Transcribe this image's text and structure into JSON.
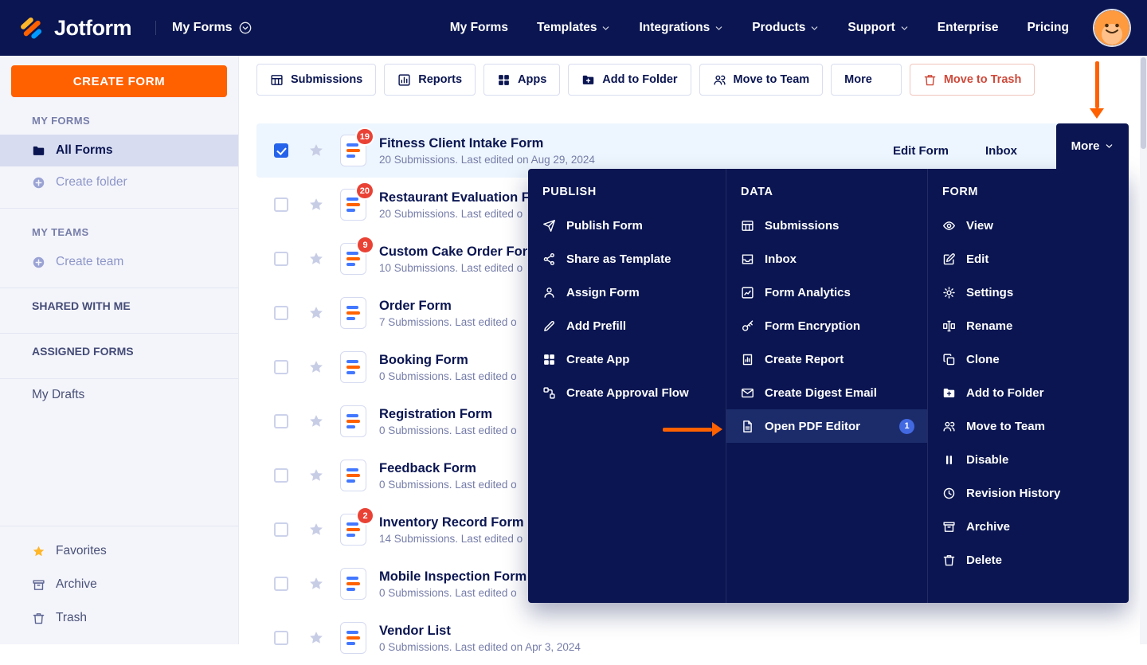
{
  "navbar": {
    "logo_text": "Jotform",
    "context_label": "My Forms",
    "items": [
      {
        "label": "My Forms",
        "chevron": false
      },
      {
        "label": "Templates",
        "chevron": true
      },
      {
        "label": "Integrations",
        "chevron": true
      },
      {
        "label": "Products",
        "chevron": true
      },
      {
        "label": "Support",
        "chevron": true
      },
      {
        "label": "Enterprise",
        "chevron": false
      },
      {
        "label": "Pricing",
        "chevron": false
      }
    ],
    "avatar_icon": "user-avatar-icon"
  },
  "sidebar": {
    "create_form_label": "CREATE FORM",
    "my_forms_heading": "MY FORMS",
    "all_forms_label": "All Forms",
    "create_folder_label": "Create folder",
    "my_teams_heading": "MY TEAMS",
    "create_team_label": "Create team",
    "shared_with_me_label": "SHARED WITH ME",
    "assigned_forms_label": "ASSIGNED FORMS",
    "my_drafts_label": "My Drafts",
    "favorites_label": "Favorites",
    "archive_label": "Archive",
    "trash_label": "Trash"
  },
  "toolbar": {
    "buttons": [
      {
        "icon": "table-icon",
        "label": "Submissions"
      },
      {
        "icon": "bar-chart-icon",
        "label": "Reports"
      },
      {
        "icon": "apps-icon",
        "label": "Apps"
      },
      {
        "icon": "folder-add-icon",
        "label": "Add to Folder"
      },
      {
        "icon": "users-icon",
        "label": "Move to Team"
      },
      {
        "icon": "",
        "label": "More",
        "chevron": true
      }
    ],
    "trash": {
      "icon": "trash-icon",
      "label": "Move to Trash"
    }
  },
  "row_actions": {
    "edit": "Edit Form",
    "inbox": "Inbox",
    "more": "More"
  },
  "forms": [
    {
      "title": "Fitness Client Intake Form",
      "subtitle": "20 Submissions. Last edited on Aug 29, 2024",
      "badge": "19",
      "checked": true,
      "selected": true,
      "show_actions": true
    },
    {
      "title": "Restaurant Evaluation Form",
      "subtitle": "20 Submissions. Last edited o",
      "badge": "20"
    },
    {
      "title": "Custom Cake Order Form",
      "subtitle": "10 Submissions. Last edited o",
      "badge": "9"
    },
    {
      "title": "Order Form",
      "subtitle": "7 Submissions. Last edited o"
    },
    {
      "title": "Booking Form",
      "subtitle": "0 Submissions. Last edited o"
    },
    {
      "title": "Registration Form",
      "subtitle": "0 Submissions. Last edited o"
    },
    {
      "title": "Feedback Form",
      "subtitle": "0 Submissions. Last edited o"
    },
    {
      "title": "Inventory Record Form",
      "subtitle": "14 Submissions. Last edited o",
      "badge": "2"
    },
    {
      "title": "Mobile Inspection Form",
      "subtitle": "0 Submissions. Last edited o"
    },
    {
      "title": "Vendor List",
      "subtitle": "0 Submissions. Last edited on Apr 3, 2024"
    }
  ],
  "menu": {
    "columns": [
      {
        "heading": "PUBLISH",
        "items": [
          {
            "icon": "send-icon",
            "label": "Publish Form"
          },
          {
            "icon": "share-icon",
            "label": "Share as Template"
          },
          {
            "icon": "user-icon",
            "label": "Assign Form"
          },
          {
            "icon": "pencil-icon",
            "label": "Add Prefill"
          },
          {
            "icon": "apps-icon",
            "label": "Create App"
          },
          {
            "icon": "flow-icon",
            "label": "Create Approval Flow"
          }
        ]
      },
      {
        "heading": "DATA",
        "items": [
          {
            "icon": "table-icon",
            "label": "Submissions"
          },
          {
            "icon": "inbox-icon",
            "label": "Inbox"
          },
          {
            "icon": "chart-icon",
            "label": "Form Analytics"
          },
          {
            "icon": "key-icon",
            "label": "Form Encryption"
          },
          {
            "icon": "report-icon",
            "label": "Create Report"
          },
          {
            "icon": "mail-icon",
            "label": "Create Digest Email"
          },
          {
            "icon": "file-icon",
            "label": "Open PDF Editor",
            "highlighted": true,
            "badge": "1"
          }
        ]
      },
      {
        "heading": "FORM",
        "items": [
          {
            "icon": "eye-icon",
            "label": "View"
          },
          {
            "icon": "edit-icon",
            "label": "Edit"
          },
          {
            "icon": "gear-icon",
            "label": "Settings"
          },
          {
            "icon": "rename-icon",
            "label": "Rename"
          },
          {
            "icon": "clone-icon",
            "label": "Clone"
          },
          {
            "icon": "folder-add-icon",
            "label": "Add to Folder"
          },
          {
            "icon": "users-icon",
            "label": "Move to Team"
          },
          {
            "icon": "pause-icon",
            "label": "Disable"
          },
          {
            "icon": "history-icon",
            "label": "Revision History"
          },
          {
            "icon": "archive-icon",
            "label": "Archive"
          },
          {
            "icon": "trash-icon",
            "label": "Delete"
          }
        ]
      }
    ]
  },
  "colors": {
    "brand_navy": "#0a1551",
    "brand_orange": "#ff6100",
    "badge_red": "#e94235",
    "checkbox_blue": "#2563eb",
    "selected_row": "#edf6fe",
    "menu_highlight": "#1c2c6b",
    "menu_badge_blue": "#4269e2",
    "trash_red": "#ce4a3b",
    "favorite_gold": "#ffb629"
  }
}
